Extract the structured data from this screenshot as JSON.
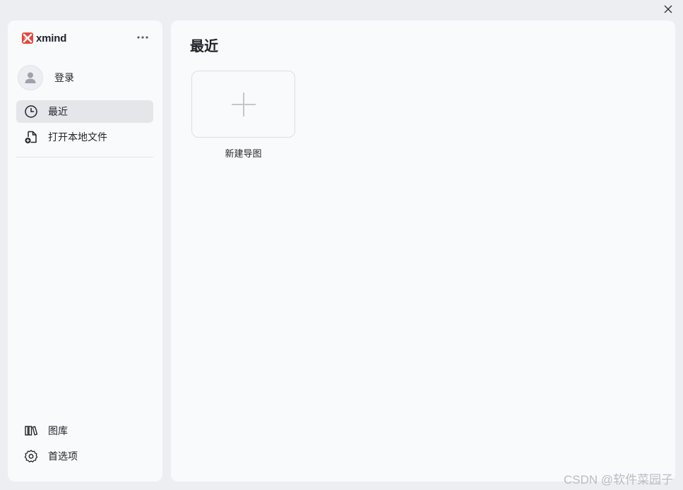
{
  "app": {
    "logo_text": "xmind"
  },
  "sidebar": {
    "login_label": "登录",
    "nav": [
      {
        "label": "最近",
        "icon": "clock-icon",
        "active": true
      },
      {
        "label": "打开本地文件",
        "icon": "open-file-icon",
        "active": false
      }
    ],
    "bottom": [
      {
        "label": "图库",
        "icon": "library-icon"
      },
      {
        "label": "首选项",
        "icon": "gear-icon"
      }
    ]
  },
  "main": {
    "title": "最近",
    "new_map_label": "新建导图"
  },
  "watermark": "CSDN @软件菜园子",
  "colors": {
    "logo_red": "#e8463b",
    "active_bg": "#e4e6ea",
    "panel_bg": "#f9fafc",
    "window_bg": "#eceef1"
  }
}
